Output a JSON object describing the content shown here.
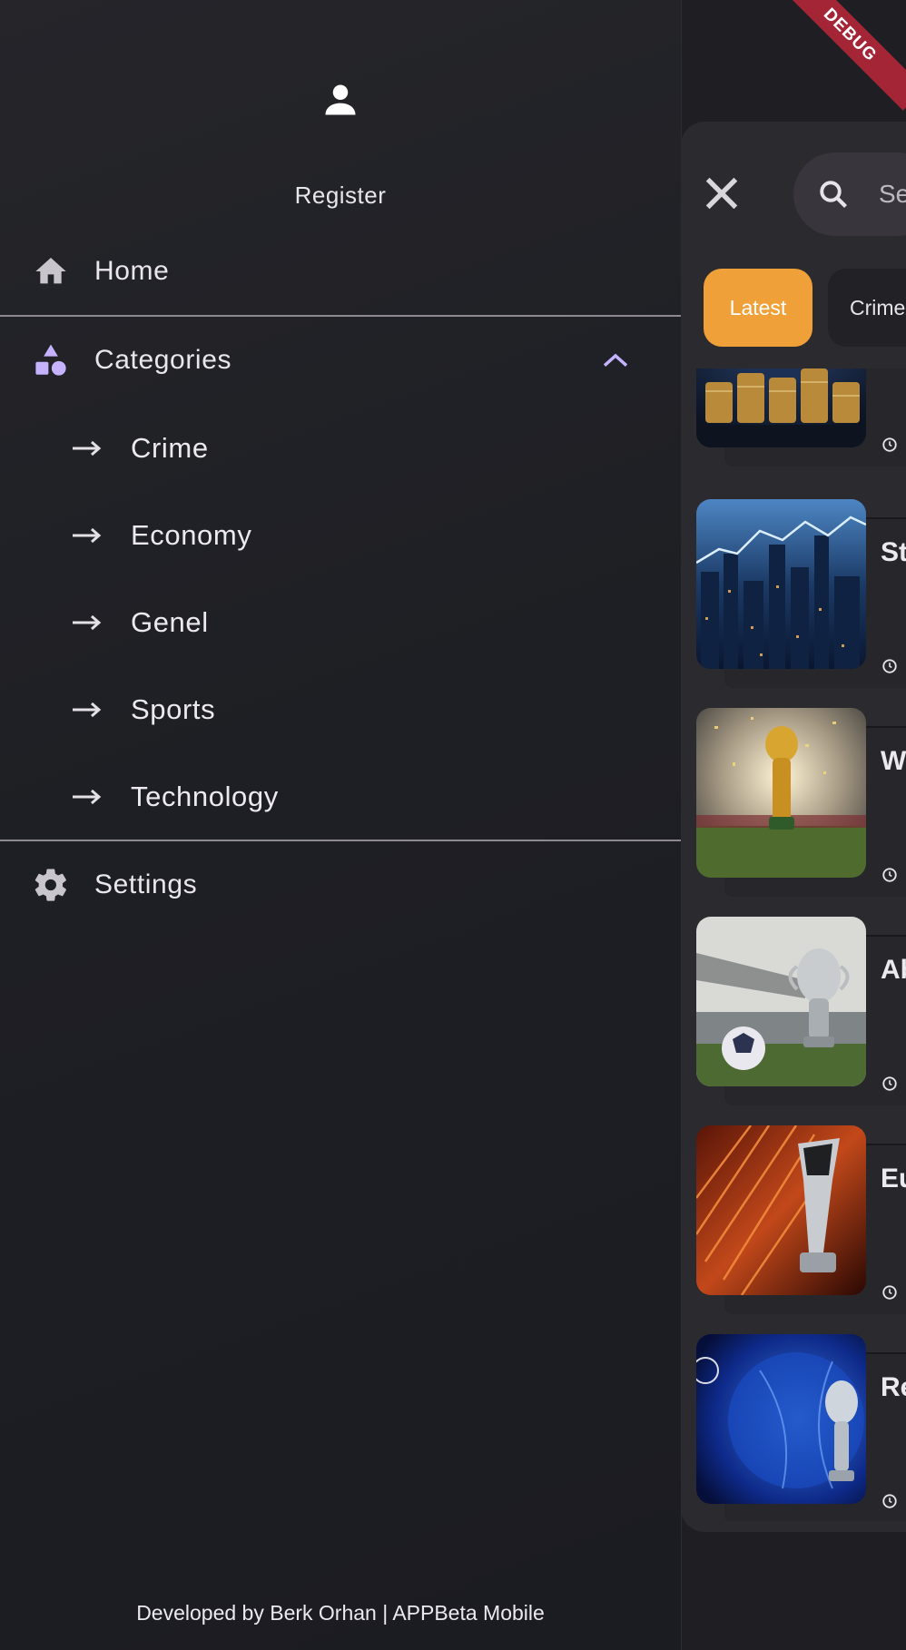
{
  "drawer": {
    "register_label": "Register",
    "home_label": "Home",
    "categories_label": "Categories",
    "categories": [
      {
        "label": "Crime"
      },
      {
        "label": "Economy"
      },
      {
        "label": "Genel"
      },
      {
        "label": "Sports"
      },
      {
        "label": "Technology"
      }
    ],
    "settings_label": "Settings",
    "footer_text": "Developed by Berk Orhan | APPBeta Mobile"
  },
  "main": {
    "search_placeholder": "Se",
    "chips": [
      {
        "label": "Latest",
        "selected": true
      },
      {
        "label": "Crime",
        "selected": false
      }
    ],
    "news": [
      {
        "title": "",
        "image": "coins-stack"
      },
      {
        "title": "St",
        "image": "city-stock-chart"
      },
      {
        "title": "W",
        "image": "world-cup-trophy"
      },
      {
        "title": "Ab",
        "image": "champions-trophy-stadium"
      },
      {
        "title": "Eu",
        "image": "europa-league-trophy"
      },
      {
        "title": "Re",
        "image": "champions-league-ball"
      }
    ]
  },
  "debug_label": "DEBUG",
  "colors": {
    "accent": "#f0a038",
    "categories_icon": "#c6b3ff",
    "drawer_bg": "#1f1f23",
    "debug_ribbon": "#a42636"
  }
}
